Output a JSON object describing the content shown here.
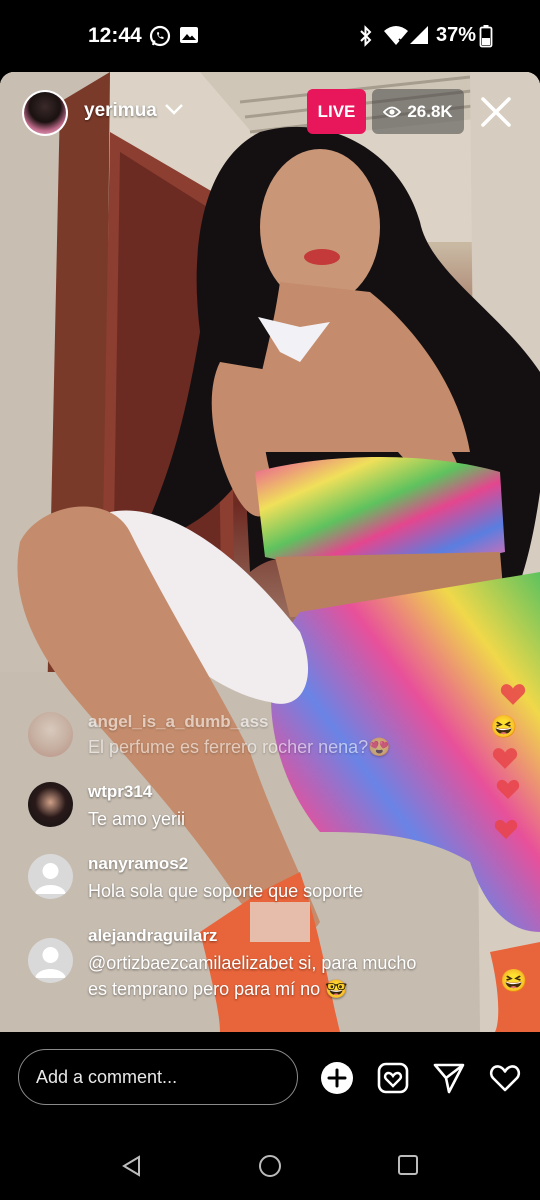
{
  "status_bar": {
    "time": "12:44",
    "battery": "37%"
  },
  "live": {
    "host_username": "yerimua",
    "live_label": "LIVE",
    "viewer_count": "26.8K"
  },
  "comments": [
    {
      "username": "angel_is_a_dumb_ass",
      "text": "El perfume es ferrero rocher nena?😍",
      "faded": true
    },
    {
      "username": "wtpr314",
      "text": "Te amo yerii"
    },
    {
      "username": "nanyramos2",
      "text": "Hola sola que soporte que soporte"
    },
    {
      "username": "alejandraguilarz",
      "text": "@ortizbaezcamilaelizabet si, para mucho es temprano pero para mí no 🤓"
    }
  ],
  "side_reactions": [
    "😆",
    "😆"
  ],
  "composer": {
    "placeholder": "Add a comment..."
  },
  "colors": {
    "live_badge": "#e8165a",
    "heart": "#e8444a"
  },
  "icons": [
    "whatsapp-icon",
    "gallery-icon",
    "bluetooth-icon",
    "wifi-icon",
    "signal-icon",
    "battery-icon",
    "chevron-down-icon",
    "eye-icon",
    "close-icon",
    "add-icon",
    "gift-frame-icon",
    "send-icon",
    "heart-icon",
    "nav-back-icon",
    "nav-home-icon",
    "nav-recents-icon"
  ]
}
